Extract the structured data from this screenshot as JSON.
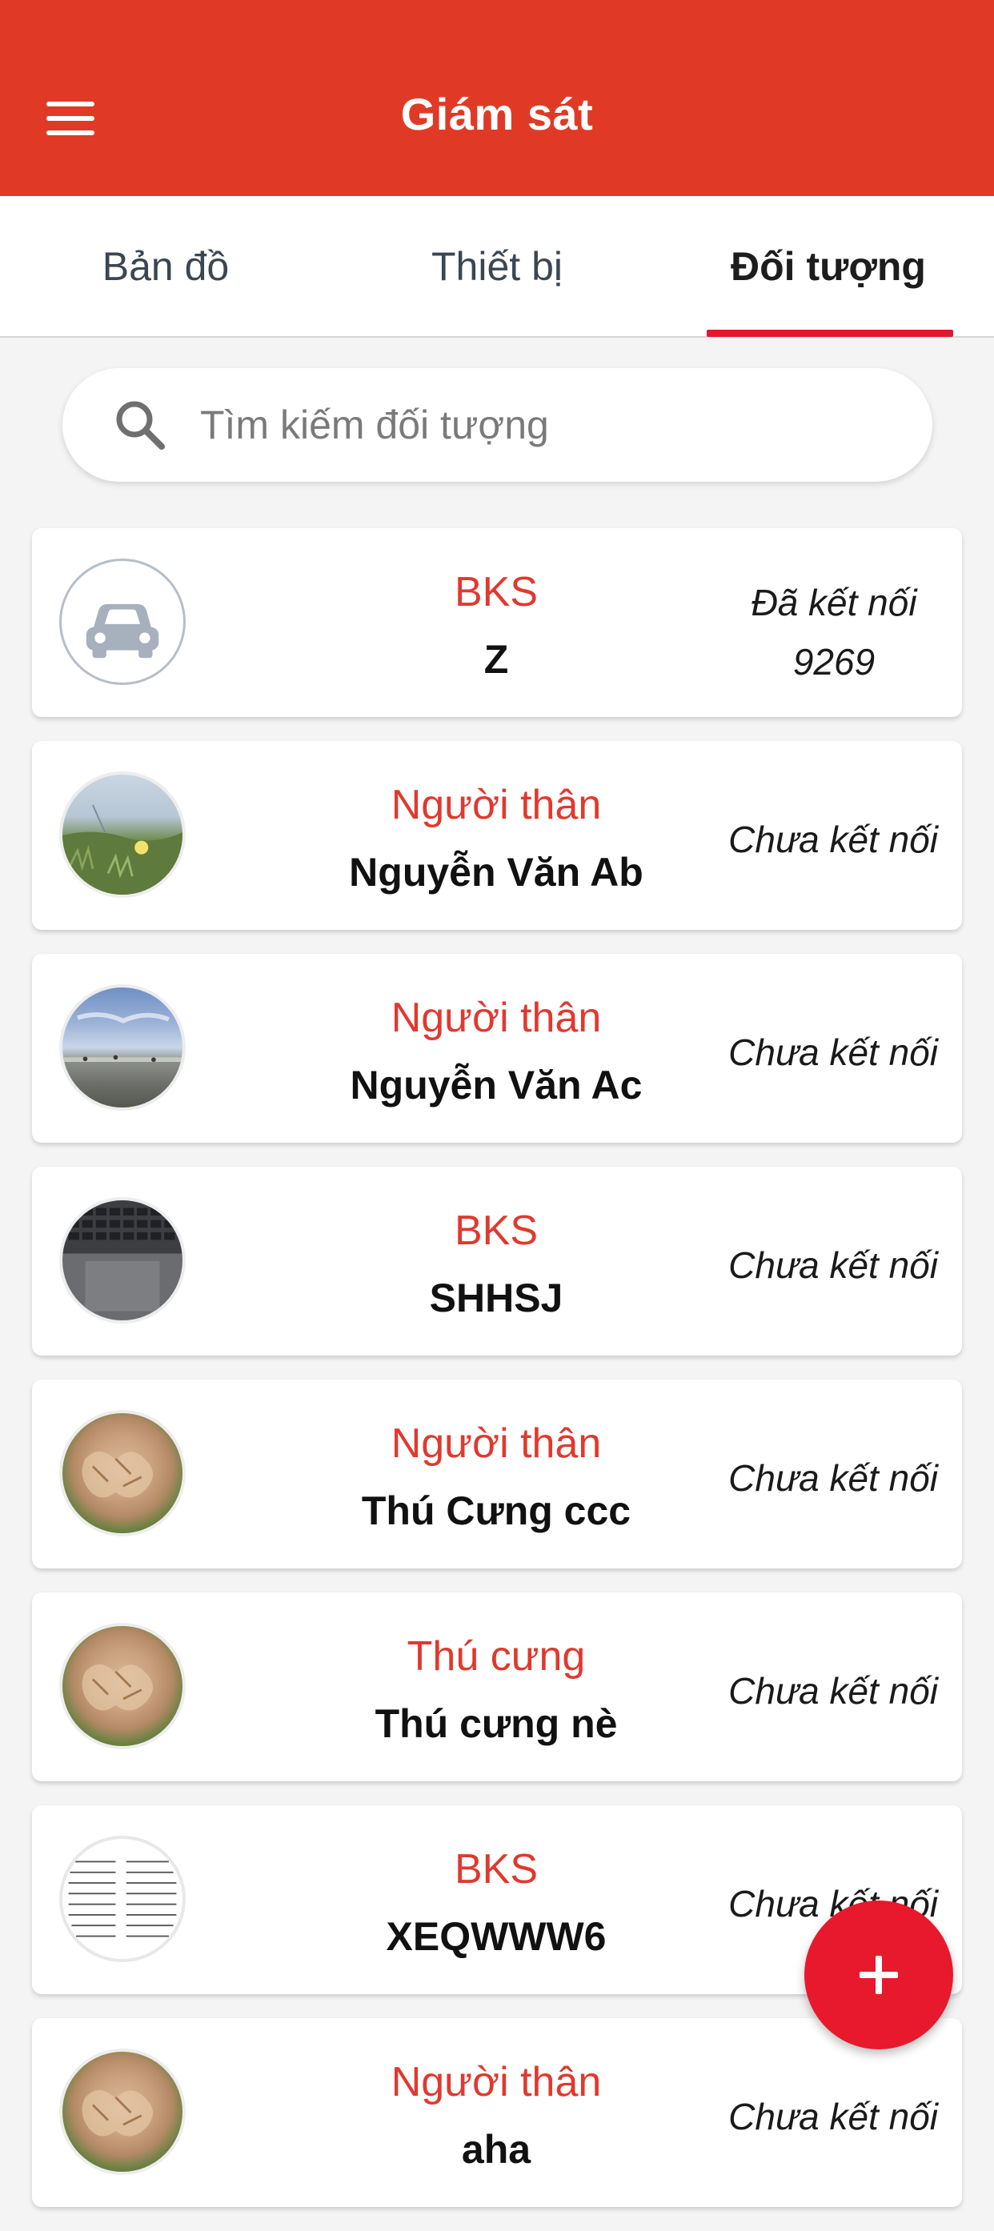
{
  "header": {
    "title": "Giám sát",
    "menu_icon": "hamburger-menu-icon",
    "background_color": "#e03a27"
  },
  "tabs": [
    {
      "label": "Bản đồ",
      "active": false
    },
    {
      "label": "Thiết bị",
      "active": false
    },
    {
      "label": "Đối tượng",
      "active": true
    }
  ],
  "search": {
    "placeholder": "Tìm kiếm đối tượng",
    "value": "",
    "icon": "search-icon"
  },
  "objects": [
    {
      "type": "BKS",
      "name": "Z",
      "status": "Đã kết nối",
      "status_code": "9269",
      "avatar": "car-icon"
    },
    {
      "type": "Người thân",
      "name": "Nguyễn Văn Ab",
      "status": "Chưa kết nối",
      "avatar": "photo-meadow"
    },
    {
      "type": "Người thân",
      "name": "Nguyễn Văn Ac",
      "status": "Chưa kết nối",
      "avatar": "photo-coast"
    },
    {
      "type": "BKS",
      "name": "SHHSJ",
      "status": "Chưa kết nối",
      "avatar": "photo-keyboard"
    },
    {
      "type": "Người thân",
      "name": "Thú Cưng ccc",
      "status": "Chưa kết nối",
      "avatar": "photo-food"
    },
    {
      "type": "Thú cưng",
      "name": "Thú cưng nè",
      "status": "Chưa kết nối",
      "avatar": "photo-food"
    },
    {
      "type": "BKS",
      "name": "XEQWWW6",
      "status": "Chưa kết nối",
      "avatar": "photo-document"
    },
    {
      "type": "Người thân",
      "name": "aha",
      "status": "Chưa kết nối",
      "avatar": "photo-food"
    }
  ],
  "fab": {
    "icon": "plus-icon",
    "color": "#e8192c"
  },
  "colors": {
    "accent": "#e03a27",
    "type_label": "#e0392f",
    "tab_indicator": "#e3182f"
  }
}
